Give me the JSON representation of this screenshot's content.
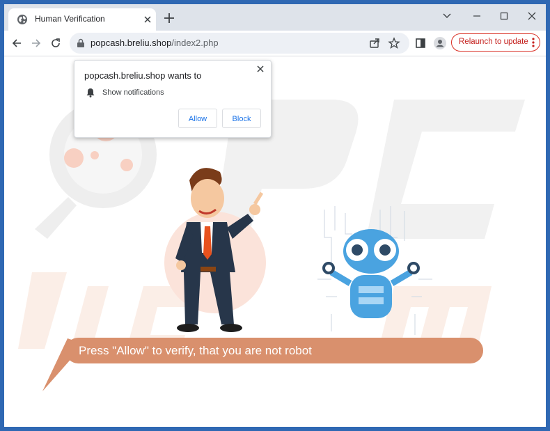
{
  "tab": {
    "title": "Human Verification",
    "favicon": "globe-icon"
  },
  "window_controls": [
    "chevron-down-icon",
    "minimize-icon",
    "maximize-icon",
    "close-icon"
  ],
  "address": {
    "host": "popcash.breliu.shop",
    "path": "/index2.php"
  },
  "toolbar": {
    "relaunch_label": "Relaunch to update"
  },
  "popup": {
    "title": "popcash.breliu.shop wants to",
    "permission": "Show notifications",
    "allow": "Allow",
    "block": "Block"
  },
  "page": {
    "message": "Press \"Allow\" to verify, that you are not robot"
  },
  "colors": {
    "window_frame": "#2f68b3",
    "tab_strip": "#dee3ea",
    "bubble": "#d9906d",
    "button_text": "#1a73e8",
    "relaunch": "#c5221f"
  }
}
